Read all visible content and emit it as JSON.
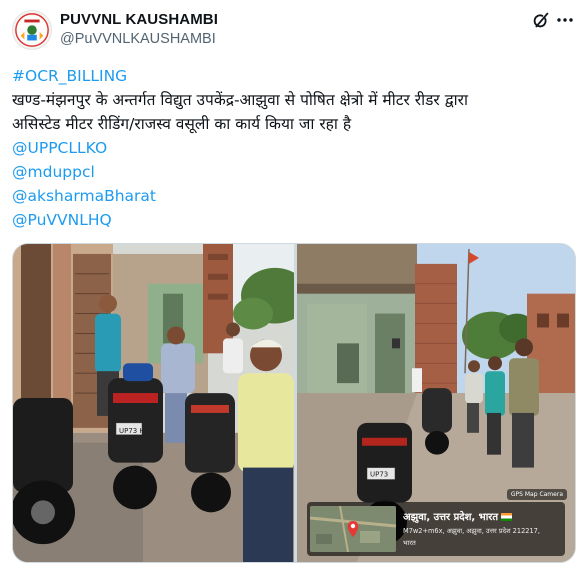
{
  "account": {
    "name": "PUVVNL KAUSHAMBI",
    "handle": "@PuVVNLKAUSHAMBI",
    "avatar_icon": "logo-avatar"
  },
  "header_icons": {
    "grok": "grok-icon",
    "more": "more-options-icon"
  },
  "tweet": {
    "hashtag": "#OCR_BILLING",
    "line1": "खण्ड-मंझनपुर के अन्तर्गत विद्युत उपकेंद्र-आझुवा से पोषित क्षेत्रो में मीटर रीडर द्वारा",
    "line2": "असिस्टेड मीटर रीडिंग/राजस्व वसूली का कार्य किया जा रहा है",
    "mentions": [
      "@UPPCLLKO",
      "@mduppcl",
      "@aksharmaBharat",
      "@PuVVNLHQ"
    ]
  },
  "media": {
    "gps": {
      "badge": "GPS Map Camera",
      "location": "अझुवा, उत्तर प्रदेश, भारत",
      "address": "M7w2+m6x, अझुवा, अझुवा, उत्तर प्रदेश 212217,",
      "country": "भारत"
    },
    "bike_plates": [
      "UP73 H",
      "UP73"
    ]
  },
  "colors": {
    "link": "#1d9bf0",
    "text": "#0f1419",
    "muted": "#536471",
    "border": "#cfd9de"
  }
}
